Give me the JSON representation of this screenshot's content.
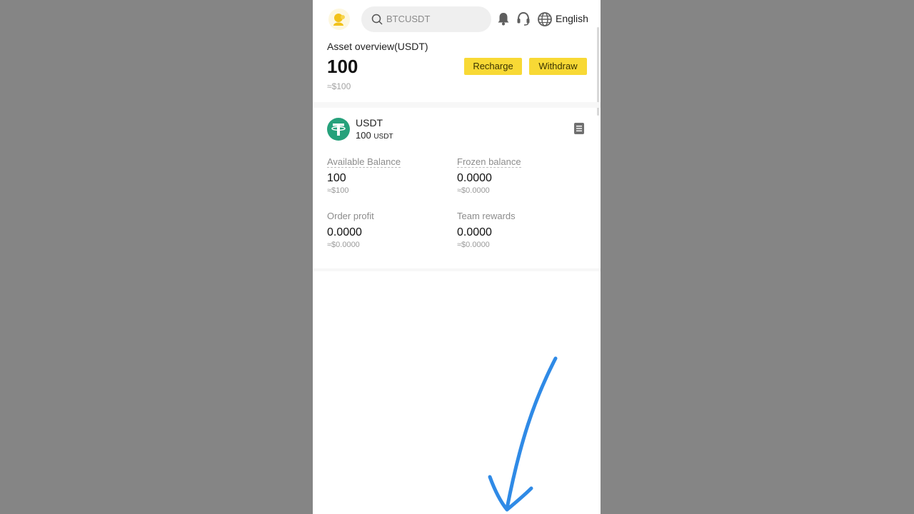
{
  "header": {
    "search_placeholder": "BTCUSDT",
    "language": "English"
  },
  "overview": {
    "title": "Asset overview(USDT)",
    "amount": "100",
    "usd_value": "≈$100",
    "recharge_label": "Recharge",
    "withdraw_label": "Withdraw"
  },
  "coin": {
    "name": "USDT",
    "amount": "100",
    "unit": "USDT"
  },
  "stats": {
    "available": {
      "label": "Available Balance",
      "value": "100",
      "usd": "≈$100"
    },
    "frozen": {
      "label": "Frozen balance",
      "value": "0.0000",
      "usd": "≈$0.0000"
    },
    "order_profit": {
      "label": "Order profit",
      "value": "0.0000",
      "usd": "≈$0.0000"
    },
    "team_rewards": {
      "label": "Team rewards",
      "value": "0.0000",
      "usd": "≈$0.0000"
    }
  },
  "colors": {
    "accent": "#f8d935",
    "tether": "#26a17b",
    "annotation_arrow": "#2f8ae6",
    "backdrop": "#858585"
  },
  "icons": [
    "avatar-icon",
    "search-icon",
    "bell-icon",
    "headset-icon",
    "globe-icon",
    "tether-icon",
    "document-icon",
    "annotation-arrow"
  ]
}
